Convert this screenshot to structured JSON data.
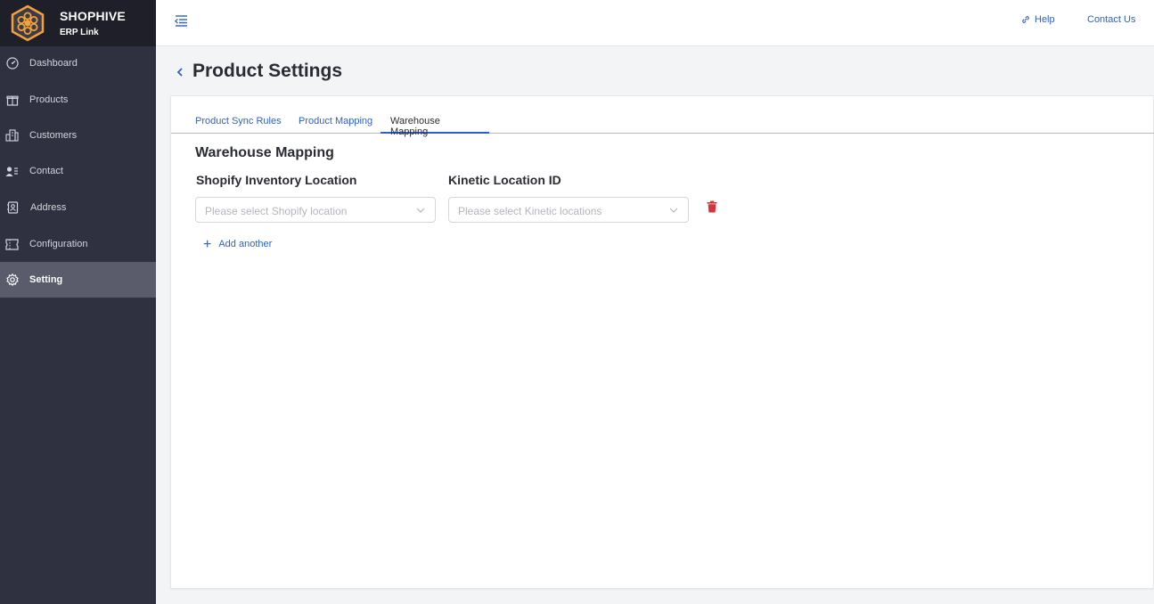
{
  "brand": {
    "title": "SHOPHIVE",
    "subtitle": "ERP Link",
    "logo_icon": "honeycomb-logo"
  },
  "sidebar": {
    "items": [
      {
        "label": "Dashboard",
        "icon": "dashboard-icon",
        "active": false
      },
      {
        "label": "Products",
        "icon": "gift-icon",
        "active": false
      },
      {
        "label": "Customers",
        "icon": "building-icon",
        "active": false
      },
      {
        "label": "Contact",
        "icon": "contact-card-icon",
        "active": false
      },
      {
        "label": "Address",
        "icon": "address-book-icon",
        "active": false
      },
      {
        "label": "Configuration",
        "icon": "ticket-icon",
        "active": false
      },
      {
        "label": "Setting",
        "icon": "gear-icon",
        "active": true
      }
    ]
  },
  "topbar": {
    "help_label": "Help",
    "contact_label": "Contact Us"
  },
  "page": {
    "title": "Product Settings"
  },
  "tabs": [
    {
      "label": "Product Sync Rules",
      "active": false
    },
    {
      "label": "Product Mapping",
      "active": false
    },
    {
      "label": "Warehouse Mapping",
      "active": true
    }
  ],
  "warehouse_mapping": {
    "section_title": "Warehouse Mapping",
    "shopify_label": "Shopify Inventory Location",
    "kinetic_label": "Kinetic Location ID",
    "shopify_placeholder": "Please select Shopify location",
    "kinetic_placeholder": "Please select Kinetic locations",
    "add_another_label": "Add another"
  },
  "colors": {
    "sidebar_bg": "#2f3140",
    "brand_bg": "#1e1f29",
    "active_item_bg": "#5a5c6c",
    "accent": "#2d5fd0",
    "danger": "#d6333b",
    "logo_orange": "#f5a13a"
  }
}
